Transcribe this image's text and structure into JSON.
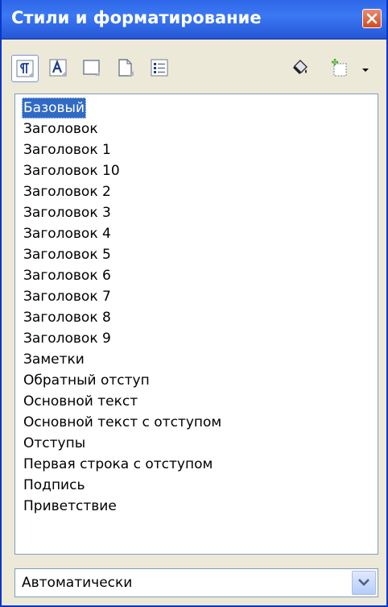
{
  "window": {
    "title": "Стили и форматирование"
  },
  "toolbar": {
    "buttons": [
      {
        "icon": "paragraph-styles-icon",
        "active": true
      },
      {
        "icon": "character-styles-icon",
        "active": false
      },
      {
        "icon": "frame-styles-icon",
        "active": false
      },
      {
        "icon": "page-styles-icon",
        "active": false
      },
      {
        "icon": "list-styles-icon",
        "active": false
      },
      {
        "icon": "fill-format-mode-icon",
        "active": false
      },
      {
        "icon": "new-style-from-selection-icon",
        "active": false
      }
    ]
  },
  "styles_list": {
    "selected_index": 0,
    "items": [
      "Базовый",
      "Заголовок",
      "Заголовок 1",
      "Заголовок 10",
      "Заголовок 2",
      "Заголовок 3",
      "Заголовок 4",
      "Заголовок 5",
      "Заголовок 6",
      "Заголовок 7",
      "Заголовок 8",
      "Заголовок 9",
      "Заметки",
      "Обратный отступ",
      "Основной текст",
      "Основной текст с отступом",
      "Отступы",
      "Первая строка с отступом",
      "Подпись",
      "Приветствие"
    ]
  },
  "filter": {
    "selected": "Автоматически"
  },
  "colors": {
    "title_bar": "#2e67e8",
    "selection": "#316ac5",
    "close_button": "#d14a24"
  }
}
